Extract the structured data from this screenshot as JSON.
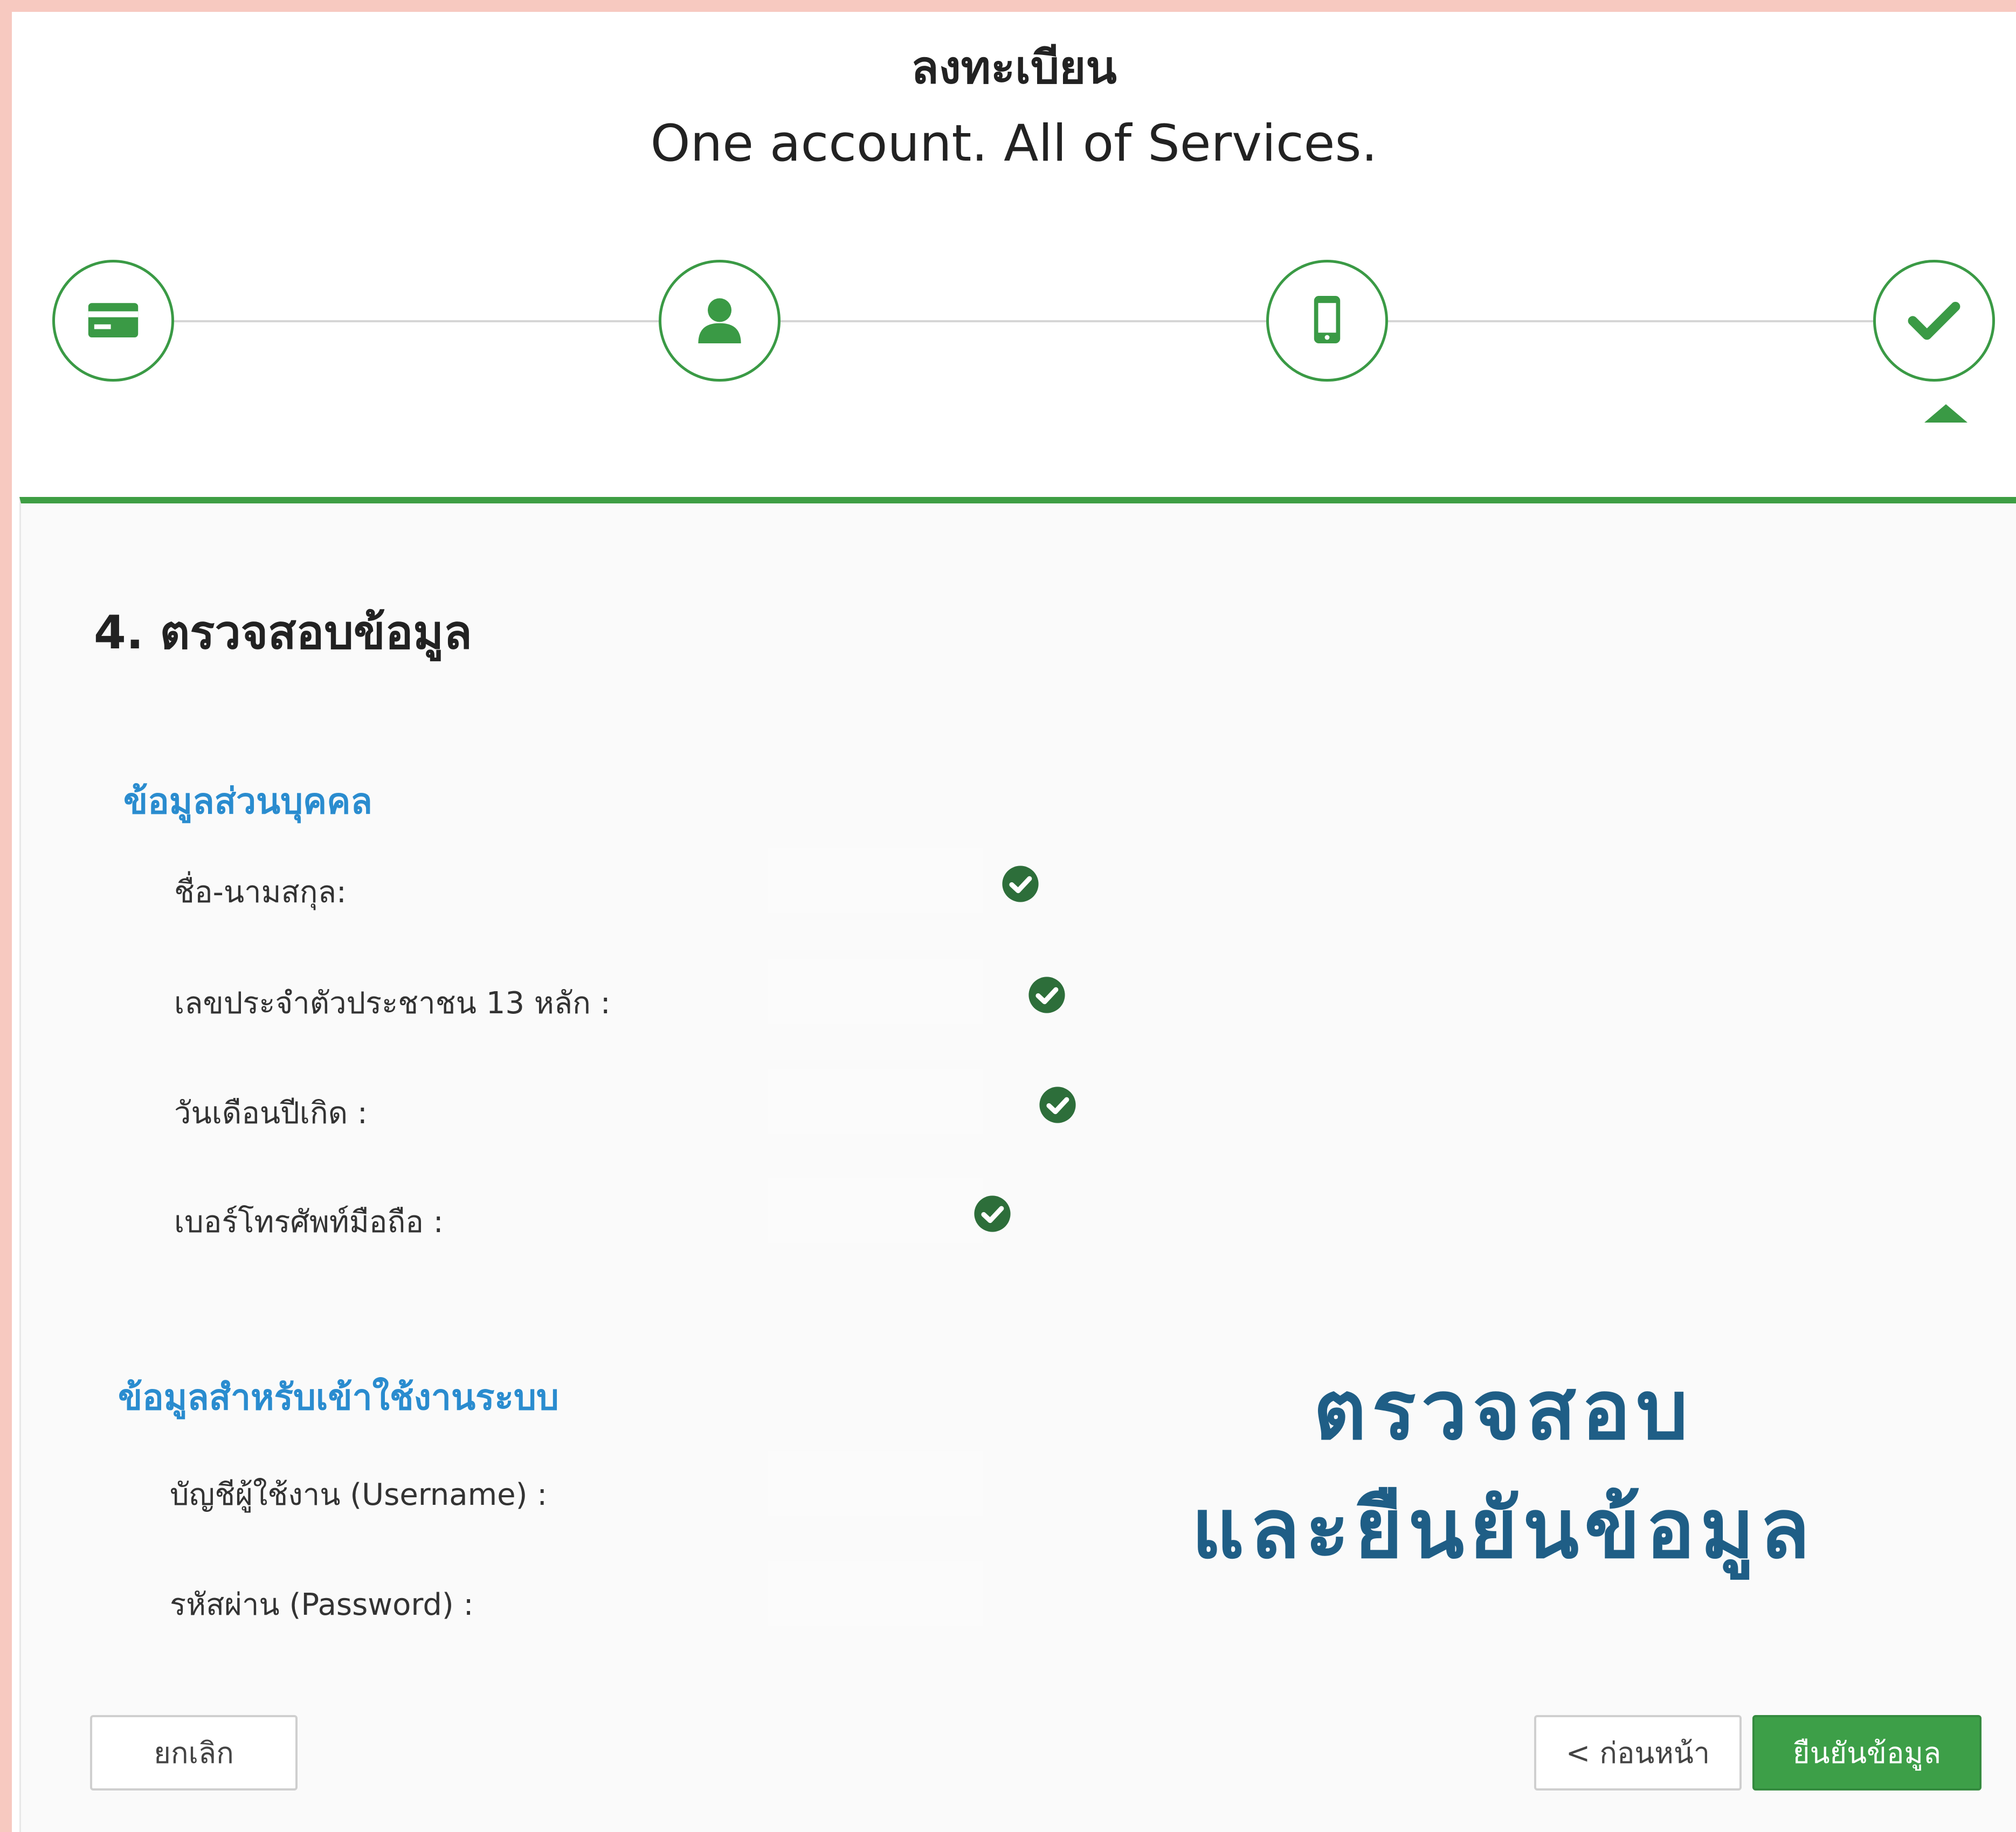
{
  "header": {
    "title": "ลงทะเบียน",
    "subtitle": "One account. All of Services."
  },
  "steps": [
    {
      "icon": "id-card-icon",
      "active": false
    },
    {
      "icon": "user-icon",
      "active": false
    },
    {
      "icon": "mobile-phone-icon",
      "active": false
    },
    {
      "icon": "checkmark-icon",
      "active": true
    }
  ],
  "section": {
    "title": "4. ตรวจสอบข้อมูล"
  },
  "personal": {
    "title": "ข้อมูลส่วนบุคคล",
    "rows": [
      {
        "label": "ชื่อ-นามสกุล:",
        "value": "",
        "verified": true
      },
      {
        "label": "เลขประจำตัวประชาชน 13 หลัก :",
        "value": "",
        "verified": true
      },
      {
        "label": "วันเดือนปีเกิด :",
        "value": "",
        "verified": true
      },
      {
        "label": "เบอร์โทรศัพท์มือถือ :",
        "value": "",
        "verified": true
      }
    ]
  },
  "login": {
    "title": "ข้อมูลสำหรับเข้าใช้งานระบบ",
    "rows": [
      {
        "label": "บัญชีผู้ใช้งาน (Username) :",
        "value": ""
      },
      {
        "label": "รหัสผ่าน (Password) :",
        "value": ""
      }
    ]
  },
  "overlay": {
    "line1": "ตรวจสอบ",
    "line2": "และยืนยันข้อมูล"
  },
  "buttons": {
    "cancel": "ยกเลิก",
    "previous": "< ก่อนหน้า",
    "confirm": "ยืนยันข้อมูล"
  },
  "colors": {
    "accent_green": "#3d9f48",
    "group_title_blue": "#2a8ccf",
    "overlay_blue": "#1f5e86",
    "check_green": "#2d6e3a"
  }
}
